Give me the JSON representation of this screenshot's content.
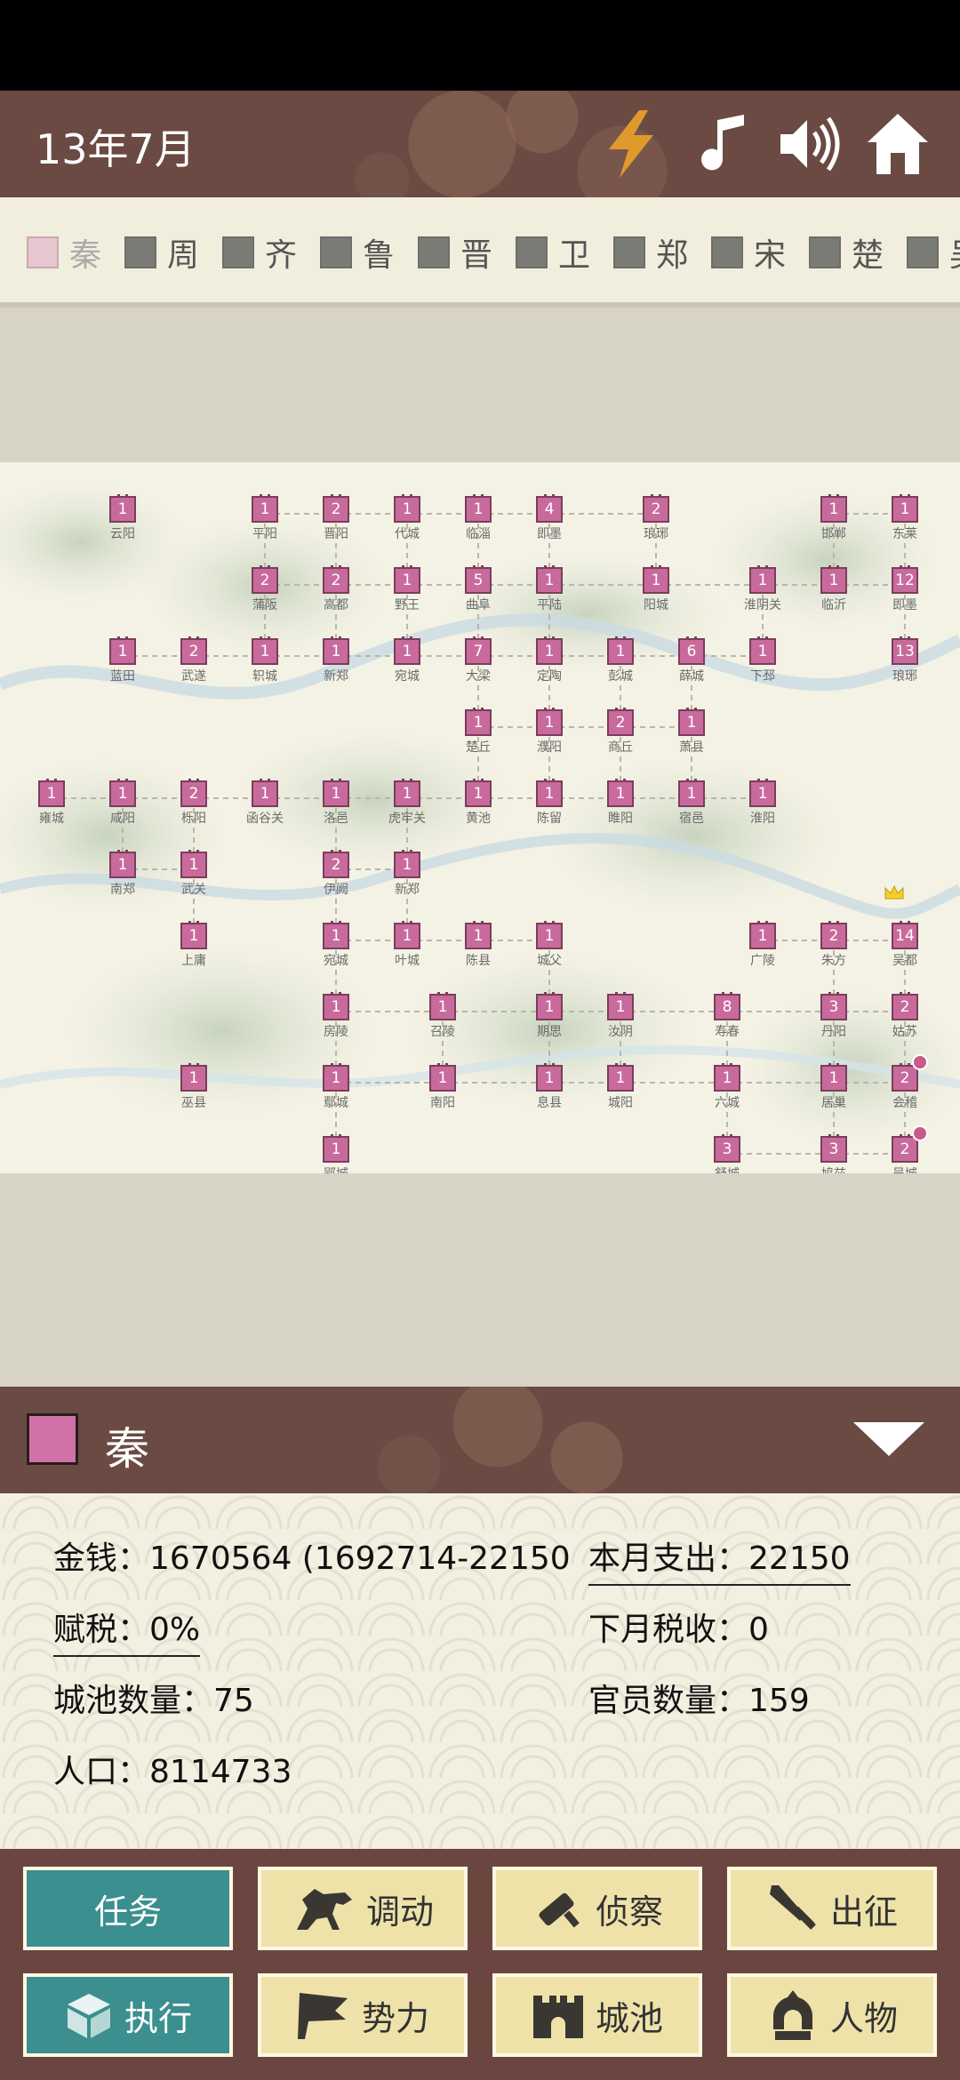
{
  "status_bar": {},
  "header": {
    "date": "13年7月",
    "icons": [
      "lightning-icon",
      "music-icon",
      "speaker-icon",
      "home-icon"
    ]
  },
  "factions": [
    {
      "name": "秦",
      "active": true
    },
    {
      "name": "周"
    },
    {
      "name": "齐"
    },
    {
      "name": "鲁"
    },
    {
      "name": "晋"
    },
    {
      "name": "卫"
    },
    {
      "name": "郑"
    },
    {
      "name": "宋"
    },
    {
      "name": "楚"
    },
    {
      "name": "吴"
    }
  ],
  "map": {
    "cities": [
      {
        "n": "1",
        "name": "云阳"
      },
      {
        "n": "1",
        "name": "平阳"
      },
      {
        "n": "2",
        "name": "晋阳"
      },
      {
        "n": "1",
        "name": "代城"
      },
      {
        "n": "1",
        "name": "临淄"
      },
      {
        "n": "4",
        "name": "即墨"
      },
      {
        "n": "2",
        "name": "琅琊"
      },
      {
        "n": "1",
        "name": "邯郸"
      },
      {
        "n": "1",
        "name": "东莱"
      },
      {
        "n": "2",
        "name": "蒲阪"
      },
      {
        "n": "2",
        "name": "高都"
      },
      {
        "n": "1",
        "name": "野王"
      },
      {
        "n": "5",
        "name": "曲阜"
      },
      {
        "n": "1",
        "name": "平陆"
      },
      {
        "n": "1",
        "name": "阳城"
      },
      {
        "n": "1",
        "name": "淮阴关"
      },
      {
        "n": "1",
        "name": "临沂"
      },
      {
        "n": "12",
        "name": "即墨"
      },
      {
        "n": "1",
        "name": "蓝田"
      },
      {
        "n": "2",
        "name": "武遂"
      },
      {
        "n": "1",
        "name": "轵城"
      },
      {
        "n": "1",
        "name": "新郑"
      },
      {
        "n": "1",
        "name": "宛城"
      },
      {
        "n": "7",
        "name": "大梁"
      },
      {
        "n": "1",
        "name": "定陶"
      },
      {
        "n": "1",
        "name": "彭城"
      },
      {
        "n": "6",
        "name": "薛城"
      },
      {
        "n": "1",
        "name": "下邳"
      },
      {
        "n": "13",
        "name": "琅琊"
      },
      {
        "n": "1",
        "name": "楚丘"
      },
      {
        "n": "1",
        "name": "濮阳"
      },
      {
        "n": "2",
        "name": "商丘"
      },
      {
        "n": "1",
        "name": "萧县"
      },
      {
        "n": "1",
        "name": "雍城"
      },
      {
        "n": "1",
        "name": "咸阳"
      },
      {
        "n": "2",
        "name": "栎阳"
      },
      {
        "n": "1",
        "name": "函谷关"
      },
      {
        "n": "1",
        "name": "洛邑"
      },
      {
        "n": "1",
        "name": "虎牢关"
      },
      {
        "n": "1",
        "name": "黄池"
      },
      {
        "n": "1",
        "name": "陈留"
      },
      {
        "n": "1",
        "name": "睢阳"
      },
      {
        "n": "1",
        "name": "宿邑"
      },
      {
        "n": "1",
        "name": "淮阳"
      },
      {
        "n": "1",
        "name": "南郑"
      },
      {
        "n": "1",
        "name": "武关"
      },
      {
        "n": "2",
        "name": "伊阙"
      },
      {
        "n": "1",
        "name": "新郑"
      },
      {
        "n": "1",
        "name": "上庸"
      },
      {
        "n": "1",
        "name": "宛城"
      },
      {
        "n": "1",
        "name": "叶城"
      },
      {
        "n": "1",
        "name": "陈县"
      },
      {
        "n": "1",
        "name": "城父"
      },
      {
        "n": "1",
        "name": "广陵"
      },
      {
        "n": "2",
        "name": "朱方"
      },
      {
        "n": "14",
        "name": "吴都"
      },
      {
        "n": "1",
        "name": "房陵"
      },
      {
        "n": "1",
        "name": "召陵"
      },
      {
        "n": "1",
        "name": "期思"
      },
      {
        "n": "1",
        "name": "汝阴"
      },
      {
        "n": "8",
        "name": "寿春"
      },
      {
        "n": "3",
        "name": "丹阳"
      },
      {
        "n": "2",
        "name": "姑苏"
      },
      {
        "n": "1",
        "name": "巫县"
      },
      {
        "n": "1",
        "name": "鄢城"
      },
      {
        "n": "1",
        "name": "南阳"
      },
      {
        "n": "1",
        "name": "息县"
      },
      {
        "n": "1",
        "name": "城阳"
      },
      {
        "n": "1",
        "name": "六城"
      },
      {
        "n": "1",
        "name": "居巢"
      },
      {
        "n": "2",
        "name": "会稽"
      },
      {
        "n": "1",
        "name": "郢城"
      },
      {
        "n": "3",
        "name": "舒城"
      },
      {
        "n": "3",
        "name": "鸠兹"
      },
      {
        "n": "2",
        "name": "吴城"
      }
    ]
  },
  "panel": {
    "title": "秦",
    "swatch_color": "#d172a6",
    "money_label": "金钱：",
    "money_value": "1670564 (1692714-22150",
    "expense_label": "本月支出：",
    "expense_value": "22150",
    "tax_label": "赋税：",
    "tax_value": "0%",
    "next_tax_label": "下月税收：",
    "next_tax_value": "0",
    "cities_label": "城池数量：",
    "cities_value": "75",
    "officials_label": "官员数量：",
    "officials_value": "159",
    "population_label": "人口：",
    "population_value": "8114733"
  },
  "actions": {
    "task": "任务",
    "move": "调动",
    "scout": "侦察",
    "campaign": "出征",
    "execute": "执行",
    "power": "势力",
    "cities": "城池",
    "people": "人物"
  }
}
